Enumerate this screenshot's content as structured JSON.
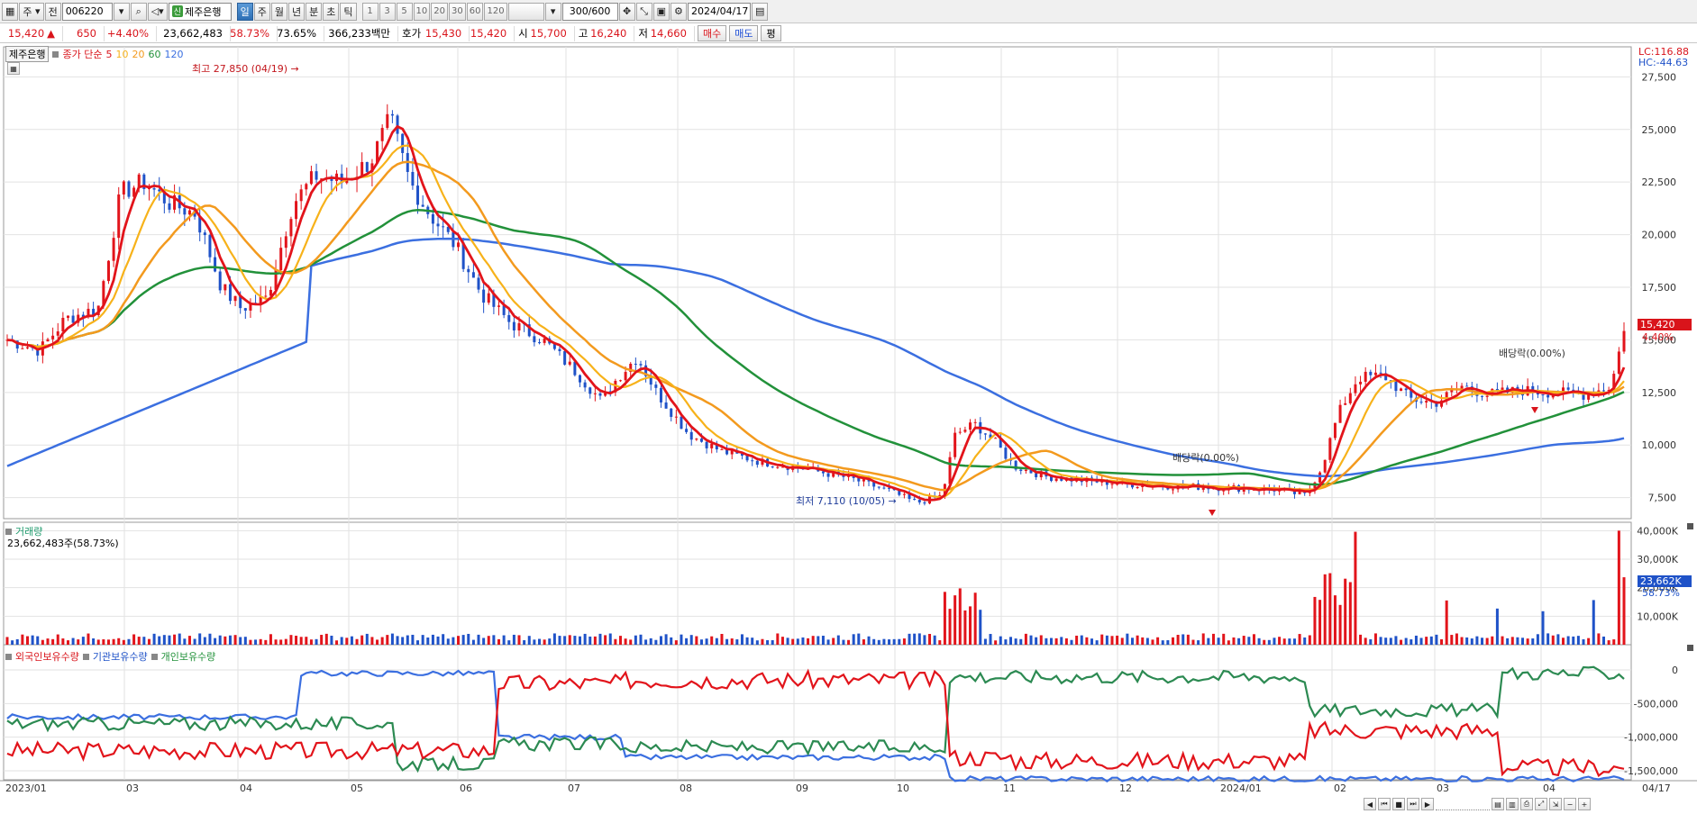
{
  "toolbar": {
    "market": "주",
    "exchange": "전",
    "code": "006220",
    "name_badge": "신",
    "name": "제주은행",
    "periods": [
      "일",
      "주",
      "월",
      "년",
      "분",
      "초",
      "틱"
    ],
    "active_period": "일",
    "intervals": [
      "1",
      "3",
      "5",
      "10",
      "20",
      "30",
      "60",
      "120"
    ],
    "count": "300/600",
    "date": "2024/04/17"
  },
  "quote": {
    "price": "15,420",
    "arrow": "▲",
    "change": "650",
    "change_pct": "+4.40%",
    "volume": "23,662,483",
    "volume_ratio": "58.73%",
    "turnover": "73.65%",
    "amount": "366,233백만",
    "bid_label": "호가",
    "bid1": "15,430",
    "bid2": "15,420",
    "open_label": "시",
    "open": "15,700",
    "high_label": "고",
    "high": "16,240",
    "low_label": "저",
    "low": "14,660",
    "buy_label": "매수",
    "sell_label": "매도",
    "eval_label": "평"
  },
  "legend_price": {
    "name": "제주은행",
    "ma_label": "종가 단순",
    "ma": [
      "5",
      "10",
      "20",
      "60",
      "120"
    ]
  },
  "legend_volume": {
    "title": "거래량",
    "value": "23,662,483주(58.73%)"
  },
  "legend_holdings": [
    "외국인보유수량",
    "기관보유수량",
    "개인보유수량"
  ],
  "annotations": {
    "high": "최고 27,850 (04/19)",
    "low": "최저 7,110 (10/05)",
    "dividend1": "배당락(0.00%)",
    "dividend2": "배당락(0.00%)"
  },
  "right_labels": {
    "lc": "LC:116.88",
    "hc": "HC:-44.63",
    "price": "15,420",
    "pct": "4.40%",
    "vol": "23,662K",
    "vol_pct": "58.73%"
  },
  "price_axis": [
    "27,500",
    "25,000",
    "22,500",
    "20,000",
    "17,500",
    "15,000",
    "12,500",
    "10,000",
    "7,500"
  ],
  "volume_axis": [
    "40,000K",
    "30,000K",
    "20,000K",
    "10,000K"
  ],
  "holdings_axis": [
    "0",
    "-500,000",
    "-1,000,000",
    "-1,500,000"
  ],
  "x_axis": [
    "2023/01",
    "03",
    "04",
    "05",
    "06",
    "07",
    "08",
    "09",
    "10",
    "11",
    "12",
    "2024/01",
    "02",
    "03",
    "04",
    "04/17"
  ],
  "colors": {
    "up": "#e2141b",
    "down": "#1f52c8",
    "ma5": "#e2141b",
    "ma10": "#f7b21a",
    "ma20": "#f39a1e",
    "ma60": "#22913a",
    "ma120": "#3b6fe0"
  },
  "chart_data": {
    "type": "line",
    "title": "제주은행",
    "x_ticks": [
      "2023/01",
      "03",
      "04",
      "05",
      "06",
      "07",
      "08",
      "09",
      "10",
      "11",
      "12",
      "2024/01",
      "02",
      "03",
      "04",
      "04/17"
    ],
    "price_close_approx": [
      {
        "x": "2023/01",
        "y": 15000
      },
      {
        "x": "02",
        "y": 22000
      },
      {
        "x": "03",
        "y": 17000
      },
      {
        "x": "04",
        "y": 23000
      },
      {
        "x": "04/19",
        "y": 25500
      },
      {
        "x": "05",
        "y": 20000
      },
      {
        "x": "06",
        "y": 14800
      },
      {
        "x": "06 end",
        "y": 12000
      },
      {
        "x": "07",
        "y": 13800
      },
      {
        "x": "08",
        "y": 9800
      },
      {
        "x": "09",
        "y": 8900
      },
      {
        "x": "10",
        "y": 7200
      },
      {
        "x": "10 end",
        "y": 11000
      },
      {
        "x": "11",
        "y": 8700
      },
      {
        "x": "12",
        "y": 8100
      },
      {
        "x": "2024/01",
        "y": 7900
      },
      {
        "x": "02",
        "y": 13000
      },
      {
        "x": "03",
        "y": 12400
      },
      {
        "x": "04",
        "y": 12500
      },
      {
        "x": "04/17",
        "y": 15420
      }
    ],
    "ma_series": [
      "5",
      "10",
      "20",
      "60",
      "120"
    ],
    "ylim": [
      6500,
      28500
    ],
    "high": 27850,
    "low": 7110,
    "last": 15420
  }
}
